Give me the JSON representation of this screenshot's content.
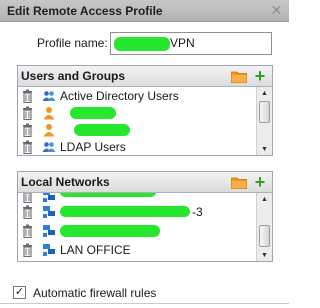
{
  "dialog": {
    "title": "Edit Remote Access Profile",
    "close_icon": "close-icon"
  },
  "profile": {
    "label": "Profile name:",
    "value_visible_suffix": "VPN"
  },
  "users_panel": {
    "title": "Users and Groups",
    "items": [
      {
        "icon": "group-icon",
        "label": "Active Directory Users",
        "redacted": false
      },
      {
        "icon": "user-icon",
        "label": "",
        "redacted": true
      },
      {
        "icon": "user-icon",
        "label": "",
        "redacted": true
      },
      {
        "icon": "group-icon",
        "label": "LDAP Users",
        "redacted": false
      }
    ]
  },
  "networks_panel": {
    "title": "Local Networks",
    "items": [
      {
        "icon": "network-icon",
        "label": "",
        "redacted": true
      },
      {
        "icon": "network-icon",
        "label": "-3",
        "redacted": true
      },
      {
        "icon": "network-icon",
        "label": "",
        "redacted": true
      },
      {
        "icon": "network-icon",
        "label": "LAN OFFICE",
        "redacted": false
      }
    ]
  },
  "firewall": {
    "label": "Automatic firewall rules",
    "checked": true
  },
  "colors": {
    "accent_green": "#2ea21f",
    "folder_orange": "#f0961c",
    "redaction": "#27e62e"
  }
}
